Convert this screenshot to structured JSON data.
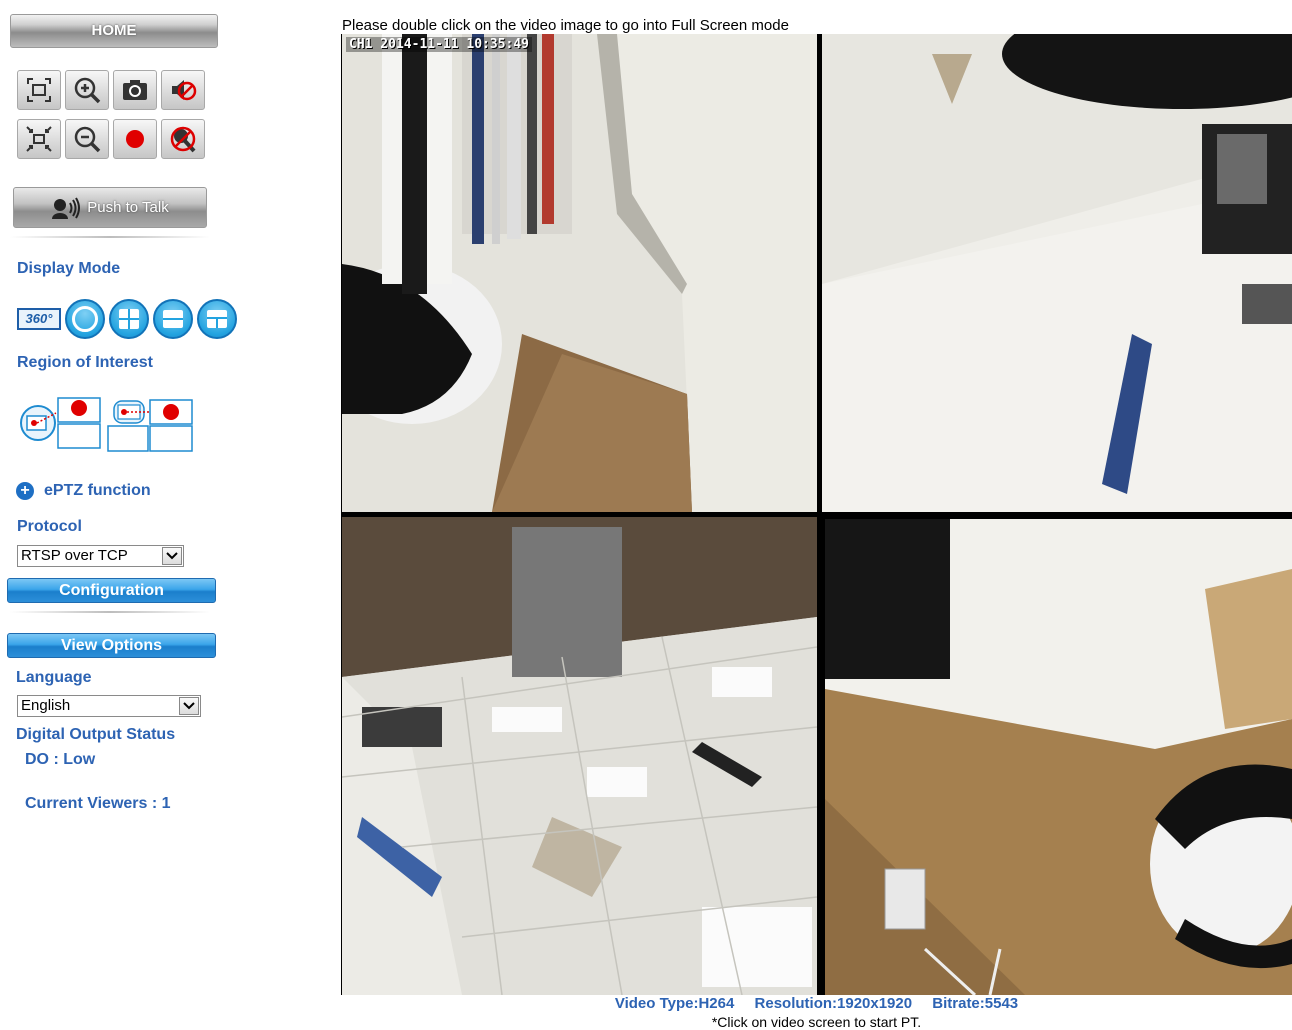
{
  "sidebar": {
    "home_label": "HOME",
    "toolbar": [
      {
        "icon": "fullscreen-icon"
      },
      {
        "icon": "zoom-in-icon"
      },
      {
        "icon": "snapshot-camera-icon"
      },
      {
        "icon": "audio-mute-icon"
      },
      {
        "icon": "exit-fullscreen-icon"
      },
      {
        "icon": "zoom-out-icon"
      },
      {
        "icon": "record-icon"
      },
      {
        "icon": "mic-mute-icon"
      }
    ],
    "push_to_talk_label": "Push to Talk",
    "display_mode_label": "Display Mode",
    "display_mode_badge": "360°",
    "region_label": "Region of Interest",
    "eptz_label": "ePTZ function",
    "protocol_label": "Protocol",
    "protocol_value": "RTSP over TCP",
    "configuration_label": "Configuration",
    "view_options_label": "View Options",
    "language_label": "Language",
    "language_value": "English",
    "digital_output_label": "Digital Output Status",
    "do_status": "DO : Low",
    "current_viewers": "Current Viewers : 1"
  },
  "video": {
    "hint": "Please double click on the video image to go into Full Screen mode",
    "osd": "CH1 2014-11-11 10:35:49",
    "video_type": "Video Type:H264",
    "resolution": "Resolution:1920x1920",
    "bitrate": "Bitrate:5543",
    "note": "*Click on video screen to start PT."
  },
  "colors": {
    "accent_blue": "#2d63b3",
    "button_blue": "#1b7fcc",
    "record_red": "#e00000"
  }
}
